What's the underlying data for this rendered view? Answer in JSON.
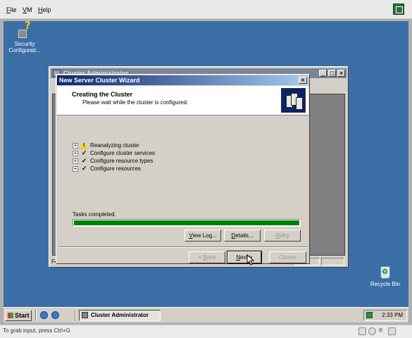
{
  "host": {
    "menu": [
      {
        "label": "File",
        "accel": "F",
        "rest": "ile"
      },
      {
        "label": "VM",
        "accel": "V",
        "rest": "M"
      },
      {
        "label": "Help",
        "accel": "H",
        "rest": "elp"
      }
    ],
    "status_text": "To grab input, press Ctrl+G"
  },
  "desktop": {
    "icons": [
      {
        "label_line1": "Security",
        "label_line2": "Configurati...",
        "icon": "security-config-icon"
      },
      {
        "label_line1": "Recycle Bin",
        "icon": "recycle-bin-icon"
      }
    ]
  },
  "cluster_admin": {
    "title": "Cluster Administrator",
    "status_text": "Fo"
  },
  "wizard": {
    "title": "New Server Cluster Wizard",
    "close_label": "×",
    "heading": "Creating the Cluster",
    "subheading": "Please wait while the cluster is configured.",
    "tasks": [
      {
        "label": "Reanalyzing cluster",
        "state": "warning",
        "state_icon": "warning-icon"
      },
      {
        "label": "Configure cluster services",
        "state": "done",
        "state_icon": "checkmark-icon"
      },
      {
        "label": "Configure resource types",
        "state": "done",
        "state_icon": "checkmark-icon"
      },
      {
        "label": "Configure resources",
        "state": "done",
        "state_icon": "checkmark-icon"
      }
    ],
    "tasks_status": "Tasks completed.",
    "progress": 1.0,
    "buttons": {
      "view_log": {
        "label": "View Log...",
        "accel": "V",
        "rest": "iew Log..."
      },
      "details": {
        "label": "Details...",
        "accel": "D",
        "rest": "etails..."
      },
      "retry": {
        "label": "Retry",
        "accel": "R",
        "rest": "etry"
      },
      "back": {
        "label": "< Back",
        "accel": "B",
        "prefix": "< ",
        "rest": "ack"
      },
      "next": {
        "label": "Next >",
        "accel": "N",
        "rest": "ext >"
      },
      "cancel": {
        "label": "Cancel"
      }
    }
  },
  "taskbar": {
    "start_label": "Start",
    "window_button": "Cluster Administrator",
    "clock": "2:33 PM"
  },
  "colors": {
    "desktop": "#3b6ea5",
    "active_title_start": "#0a246a",
    "active_title_end": "#a6caf0",
    "progress_fill": "#008000"
  }
}
